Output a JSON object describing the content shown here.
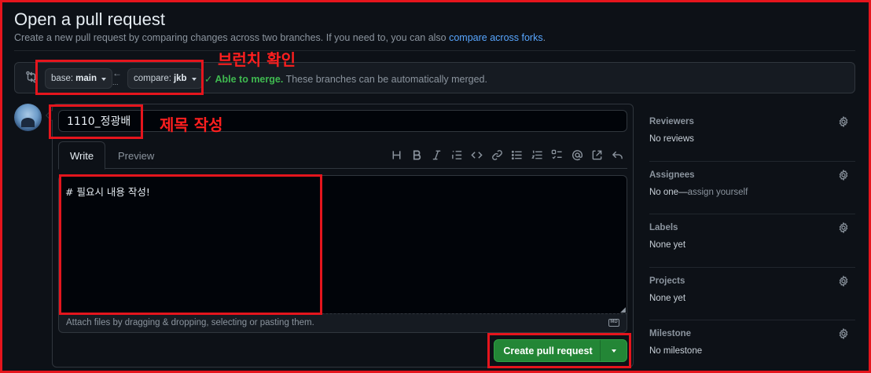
{
  "page": {
    "title": "Open a pull request",
    "subtitle": "Create a new pull request by comparing changes across two branches. If you need to, you can also ",
    "subtitle_link": "compare across forks",
    "subtitle_end": "."
  },
  "compare": {
    "base_prefix": "base:",
    "base_branch": "main",
    "compare_prefix": "compare:",
    "compare_branch": "jkb",
    "swap_arrow": "←",
    "swap_dots": "...",
    "merge_check": "✓",
    "merge_status": "Able to merge.",
    "merge_message": "These branches can be automatically merged."
  },
  "form": {
    "title_value": "1110_정광배",
    "tabs": [
      "Write",
      "Preview"
    ],
    "body_value": "# 필요시 내용 작성!",
    "attach_text": "Attach files by dragging & dropping, selecting or pasting them.",
    "markdown_badge": "MD",
    "submit_label": "Create pull request",
    "toolbar_icons": [
      "heading-icon",
      "bold-icon",
      "italic-icon",
      "quote-icon",
      "code-icon",
      "link-icon",
      "unordered-list-icon",
      "ordered-list-icon",
      "task-list-icon",
      "mention-icon",
      "cross-reference-icon",
      "reply-icon"
    ]
  },
  "sidebar": {
    "reviewers": {
      "label": "Reviewers",
      "value": "No reviews"
    },
    "assignees": {
      "label": "Assignees",
      "value_prefix": "No one—",
      "value_muted": "assign yourself"
    },
    "labels": {
      "label": "Labels",
      "value": "None yet"
    },
    "projects": {
      "label": "Projects",
      "value": "None yet"
    },
    "milestone": {
      "label": "Milestone",
      "value": "No milestone"
    }
  },
  "annotations": {
    "branch_check": "브런치 확인",
    "title_write": "제목 작성"
  },
  "colors": {
    "background": "#0d1117",
    "accent_link": "#58a6ff",
    "merge_ok": "#3fb950",
    "submit": "#238636",
    "annotation": "#e5151d"
  }
}
